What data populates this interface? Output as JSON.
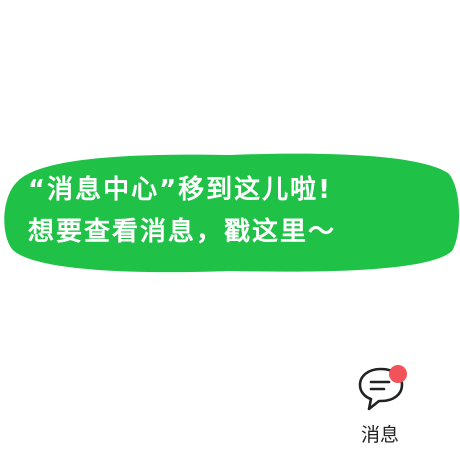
{
  "tip": {
    "line1": "“消息中心”移到这儿啦!",
    "line2": "想要查看消息，戳这里～",
    "bubble_color": "#1fc147",
    "text_color": "#ffffff"
  },
  "message_entry": {
    "label": "消息",
    "icon": "chat-bubble-icon",
    "badge_color": "#f2535a",
    "has_unread": true
  }
}
